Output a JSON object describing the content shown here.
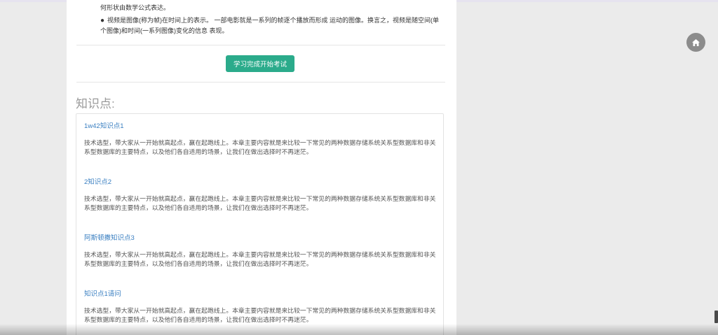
{
  "intro": {
    "line1": "何形状由数学公式表达。",
    "bullet": "视频是图像(称为帧)在时间上的表示。 一部电影就是一系列的帧逐个播放而形成 运动的图像。换言之，视频是随空间(单个图像)和时间(一系列图像)变化的信息 表现。"
  },
  "exam_button": {
    "label": "学习完成开始考试"
  },
  "knowledge": {
    "heading": "知识点:",
    "items": [
      {
        "title": "1w42知识点1",
        "desc": "技术选型，带大家从一开始就高起点，赢在起跑线上。本章主要内容就是来比较一下常见的两种数据存储系统关系型数据库和非关系型数据库的主要特点，以及他们各自适用的场景，让我们在做出选择时不再迷茫。"
      },
      {
        "title": "2知识点2",
        "desc": "技术选型，带大家从一开始就高起点，赢在起跑线上。本章主要内容就是来比较一下常见的两种数据存储系统关系型数据库和非关系型数据库的主要特点，以及他们各自适用的场景，让我们在做出选择时不再迷茫。"
      },
      {
        "title": "阿斯顿撒知识点3",
        "desc": "技术选型，带大家从一开始就高起点，赢在起跑线上。本章主要内容就是来比较一下常见的两种数据存储系统关系型数据库和非关系型数据库的主要特点，以及他们各自适用的场景，让我们在做出选择时不再迷茫。"
      },
      {
        "title": "知识点1请问",
        "desc": "技术选型，带大家从一开始就高起点，赢在起跑线上。本章主要内容就是来比较一下常见的两种数据存储系统关系型数据库和非关系型数据库的主要特点，以及他们各自适用的场景，让我们在做出选择时不再迷茫。"
      }
    ]
  },
  "floating": {
    "home_icon": "home-icon"
  },
  "colors": {
    "accent": "#2bab8b",
    "link": "#3a7fc1",
    "background": "#ebebeb"
  }
}
